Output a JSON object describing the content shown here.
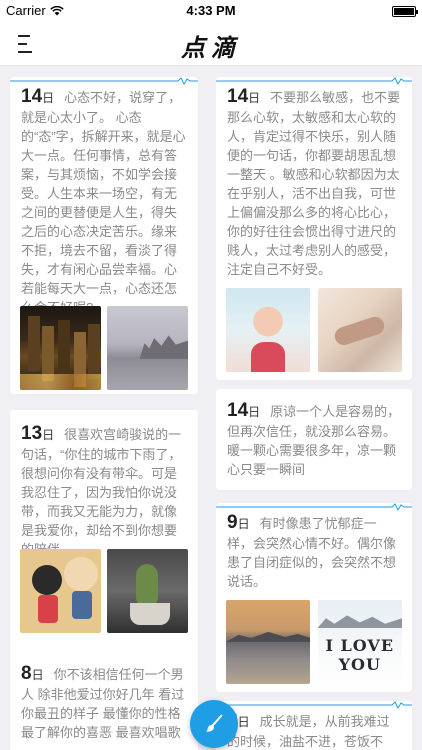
{
  "status_bar": {
    "carrier": "Carrier",
    "time": "4:33 PM"
  },
  "nav": {
    "title": "点滴",
    "menu_icon": "menu-icon"
  },
  "accent_color": "#1f9ee6",
  "left_column": [
    {
      "day": "14",
      "unit": "日",
      "text": "心态不好，说穿了，就是心太小了。 心态的“态”字，拆解开来，就是心大一点。任何事情，总有答案，与其烦恼，不如学会接受。人生本来一场空，有无之间的更替便是人生，得失之后的心态决定苦乐。缘来不拒，境去不留，看淡了得失，才有闲心品尝幸福。心若能每天大一点，心态还怎么会不好呢?",
      "photos": [
        "night-city-photo",
        "harbor-photo"
      ]
    },
    {
      "day": "13",
      "unit": "日",
      "text": "很喜欢宫崎骏说的一句话，“你住的城市下雨了，很想问你有没有带伞。可是我忍住了，因为我怕你说没带，而我又无能为力，就像是我爱你，却给不到你想要的陪伴",
      "photos": [
        "cartoon-couple-photo",
        "cactus-photo"
      ]
    },
    {
      "day": "8",
      "unit": "日",
      "text": "你不该相信任何一个男人 除非他爱过你好几年 看过你最丑的样子 最懂你的性格 最了解你的喜恶 最喜欢唱歌",
      "photos": []
    }
  ],
  "right_column": [
    {
      "day": "14",
      "unit": "日",
      "text": "不要那么敏感，也不要那么心软，太敏感和太心软的人，肯定过得不快乐，别人随便的一句话，你都要胡思乱想一整天 。敏感和心软都因为太在乎别人，活不出自我，可世上偏偏没那么多的将心比心，你的好往往会惯出得寸进尺的贱人，太过考虑别人的感受，注定自己不好受。",
      "photos": [
        "baby-photo",
        "holding-hands-photo"
      ]
    },
    {
      "day": "14",
      "unit": "日",
      "text": "原谅一个人是容易的，但再次信任，就没那么容易。暖一颗心需要很多年，凉一颗心只要一瞬间",
      "photos": []
    },
    {
      "day": "9",
      "unit": "日",
      "text": "有时像患了忧郁症一样，会突然心情不好。偶尔像患了自闭症似的，会突然不想说话。",
      "photos": [
        "river-city-photo",
        "snow-love-photo"
      ],
      "snow_caption": "I LOVE YOU"
    },
    {
      "day": "8",
      "unit": "日",
      "text": "成长就是，从前我难过的时候，油盐不进，苍饭不",
      "photos": []
    }
  ],
  "fab": {
    "icon": "brush-icon"
  }
}
